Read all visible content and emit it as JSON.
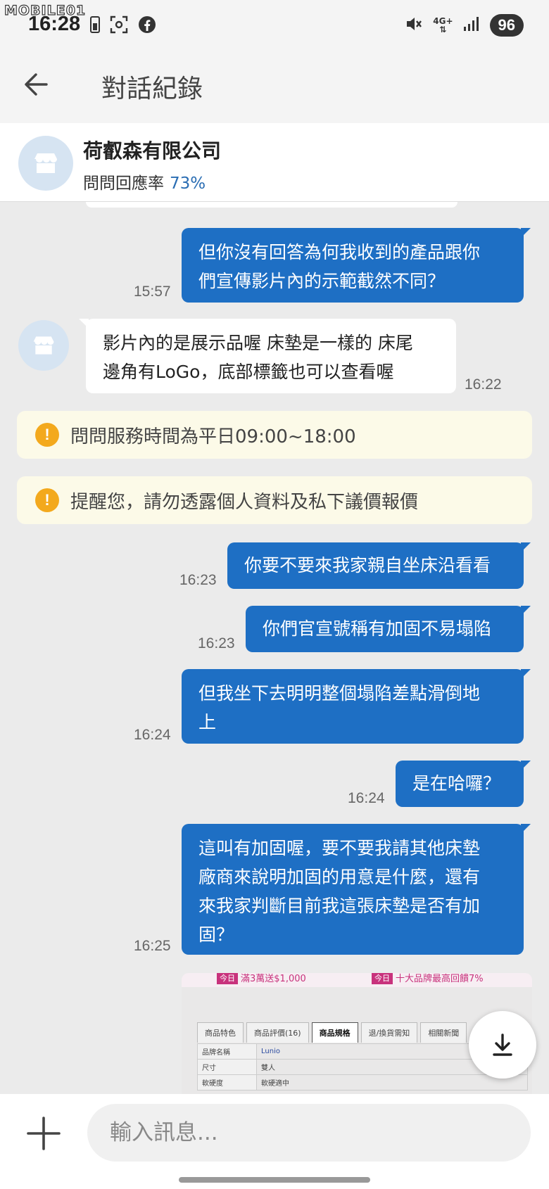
{
  "status_bar": {
    "watermark": "MOBILE01",
    "time": "16:28",
    "network": "4G+",
    "battery": "96"
  },
  "header": {
    "title": "對話紀錄"
  },
  "shop": {
    "name": "荷叡森有限公司",
    "rate_label": "問問回應率",
    "rate_value": "73%"
  },
  "messages": [
    {
      "dir": "out",
      "lines": [
        "但你沒有回答為何我收到的產品跟你",
        "們宣傳影片內的示範截然不同？"
      ],
      "time": "15:57"
    },
    {
      "dir": "in",
      "lines": [
        "影片內的是展示品喔 床墊是一樣的 床尾",
        "邊角有LoGo，底部標籤也可以查看喔"
      ],
      "time": "16:22"
    },
    {
      "dir": "notice",
      "text": "問問服務時間為平日09:00~18:00"
    },
    {
      "dir": "notice",
      "text": "提醒您，請勿透露個人資料及私下議價報價"
    },
    {
      "dir": "out",
      "lines": [
        "你要不要來我家親自坐床沿看看"
      ],
      "time": "16:23"
    },
    {
      "dir": "out",
      "lines": [
        "你們官宣號稱有加固不易塌陷"
      ],
      "time": "16:23"
    },
    {
      "dir": "out",
      "lines": [
        "但我坐下去明明整個塌陷差點滑倒地",
        "上"
      ],
      "time": "16:24"
    },
    {
      "dir": "out",
      "lines": [
        "是在哈囉？"
      ],
      "time": "16:24"
    },
    {
      "dir": "out",
      "lines": [
        "這叫有加固喔，要不要我請其他床墊",
        "廠商來說明加固的用意是什麼，還有",
        "來我家判斷目前我這張床墊是否有加",
        "固？"
      ],
      "time": "16:25"
    }
  ],
  "attachment": {
    "promo_left_tag": "今日",
    "promo_left_text": "滿3萬送$1,000",
    "promo_right_tag": "今日",
    "promo_right_text": "十大品牌最高回饋7%",
    "tabs": [
      "商品特色",
      "商品評價(16)",
      "商品規格",
      "退/換貨需知",
      "相關新聞"
    ],
    "rows": [
      {
        "label": "品牌名稱",
        "value": "Lunio"
      },
      {
        "label": "尺寸",
        "value": "雙人"
      },
      {
        "label": "軟硬度",
        "value": "軟硬適中"
      }
    ]
  },
  "input": {
    "placeholder": "輸入訊息..."
  }
}
